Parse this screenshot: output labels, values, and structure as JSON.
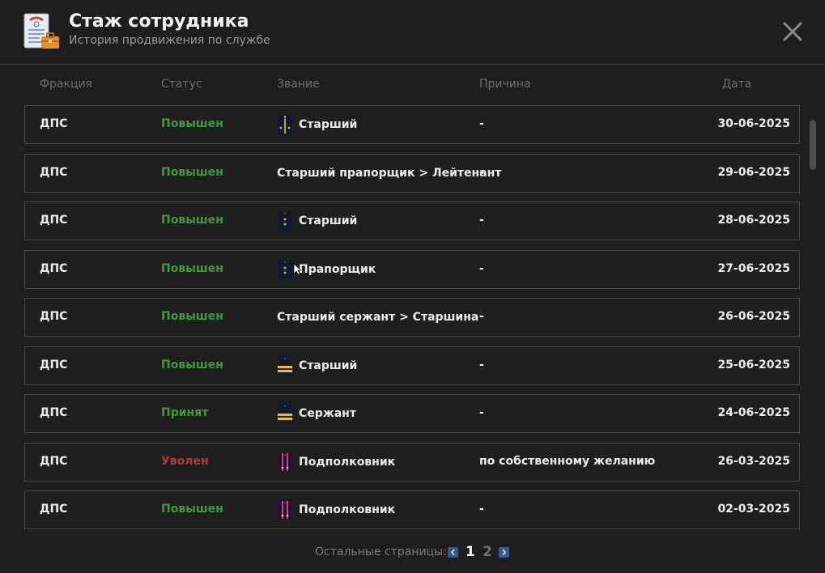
{
  "header": {
    "title": "Стаж сотрудника",
    "subtitle": "История продвижения по службе"
  },
  "columns": {
    "faction": "Фракция",
    "status": "Статус",
    "rank": "Звание",
    "reason": "Причина",
    "date": "Дата"
  },
  "rows": [
    {
      "faction": "ДПС",
      "status": "Повышен",
      "status_type": "ok",
      "rank_icon": "epaulette-lt-icon",
      "rank": "Старший",
      "reason": "-",
      "date": "30-06-2025"
    },
    {
      "faction": "ДПС",
      "status": "Повышен",
      "status_type": "ok",
      "rank_icon": "",
      "rank": "Старший прапорщик > Лейтенант",
      "reason": "-",
      "date": "29-06-2025"
    },
    {
      "faction": "ДПС",
      "status": "Повышен",
      "status_type": "ok",
      "rank_icon": "epaulette-ensign-icon",
      "rank": "Старший",
      "reason": "-",
      "date": "28-06-2025"
    },
    {
      "faction": "ДПС",
      "status": "Повышен",
      "status_type": "ok",
      "rank_icon": "epaulette-ensign-icon",
      "rank": "Прапорщик",
      "reason": "-",
      "date": "27-06-2025"
    },
    {
      "faction": "ДПС",
      "status": "Повышен",
      "status_type": "ok",
      "rank_icon": "",
      "rank": "Старший сержант > Старшина",
      "reason": "-",
      "date": "26-06-2025"
    },
    {
      "faction": "ДПС",
      "status": "Повышен",
      "status_type": "ok",
      "rank_icon": "epaulette-sergeant-icon",
      "rank": "Старший",
      "reason": "-",
      "date": "25-06-2025"
    },
    {
      "faction": "ДПС",
      "status": "Принят",
      "status_type": "ok",
      "rank_icon": "epaulette-sergeant-icon",
      "rank": "Сержант",
      "reason": "-",
      "date": "24-06-2025"
    },
    {
      "faction": "ДПС",
      "status": "Уволен",
      "status_type": "bad",
      "rank_icon": "epaulette-ltcol-icon",
      "rank": "Подполковник",
      "reason": "по собственному желанию",
      "date": "26-03-2025"
    },
    {
      "faction": "ДПС",
      "status": "Повышен",
      "status_type": "ok",
      "rank_icon": "epaulette-ltcol-icon",
      "rank": "Подполковник",
      "reason": "-",
      "date": "02-03-2025"
    }
  ],
  "pagination": {
    "label": "Остальные страницы:",
    "pages": [
      "1",
      "2"
    ],
    "current": "1"
  },
  "colors": {
    "status_ok": "#3f9c3a",
    "status_bad": "#b53c3c",
    "page_button": "#3a5a86"
  }
}
